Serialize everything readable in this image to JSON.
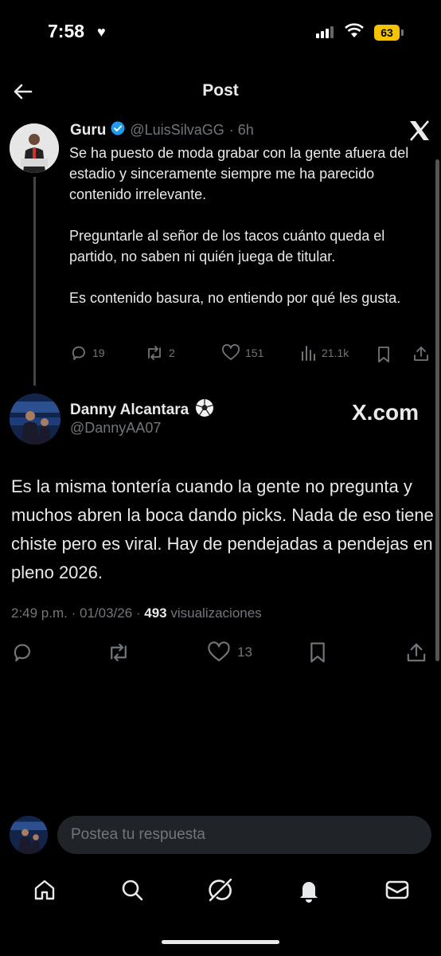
{
  "status": {
    "time": "7:58",
    "battery": "63"
  },
  "header": {
    "title": "Post"
  },
  "quoted": {
    "name": "Guru",
    "handle": "@LuisSilvaGG",
    "time": "· 6h",
    "text": "Se ha puesto de moda grabar con la gente afuera del estadio y sinceramente siempre me ha parecido contenido irrelevante.\n\nPreguntarle al señor de los tacos cuánto queda el partido, no saben ni quién juega de titular.\n\nEs contenido basura, no entiendo por qué les gusta.",
    "stats": {
      "replies": "19",
      "reposts": "2",
      "likes": "151",
      "views": "21.1k"
    }
  },
  "reply": {
    "name": "Danny Alcantara",
    "handle": "@DannyAA07",
    "brand": "X.com",
    "text": "Es la misma tontería cuando la gente no pregunta y muchos abren la boca dando picks. Nada de eso tiene chiste pero es viral. Hay de pendejadas a pendejas en pleno 2026.",
    "time": "2:49 p.m. · 01/03/26 · ",
    "views_count": "493",
    "views_label": " visualizaciones",
    "likes": "13"
  },
  "composer": {
    "placeholder": "Postea tu respuesta"
  },
  "icons": [
    "back-arrow-icon",
    "x-logo-icon",
    "verified-icon",
    "soccer-ball-icon",
    "reply-icon",
    "repost-icon",
    "like-icon",
    "views-icon",
    "bookmark-icon",
    "share-icon",
    "home-icon",
    "search-icon",
    "grok-icon",
    "notifications-icon",
    "messages-icon"
  ],
  "colors": {
    "background": "#000000",
    "verified": "#1d9bf0",
    "muted": "#71767b",
    "battery": "#f5c400"
  }
}
